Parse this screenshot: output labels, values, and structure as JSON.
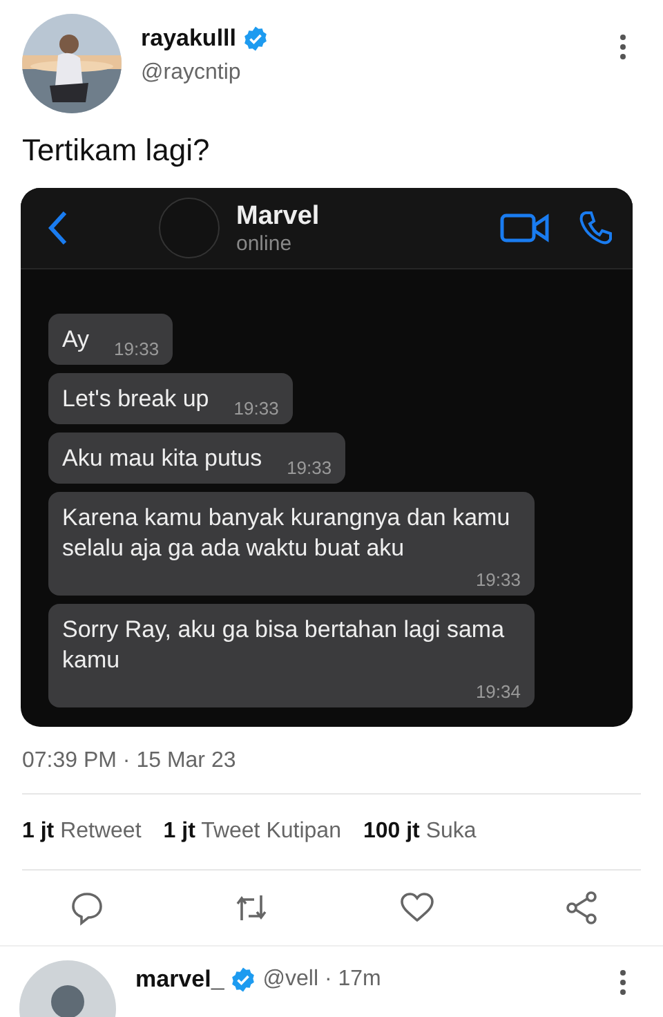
{
  "tweet": {
    "author": {
      "name": "rayakulll",
      "verified": true,
      "handle": "@raycntip"
    },
    "text": "Tertikam lagi?",
    "chat": {
      "contact": "Marvel",
      "status": "online",
      "messages": [
        {
          "text": "Ay",
          "time": "19:33"
        },
        {
          "text": "Let's break up",
          "time": "19:33"
        },
        {
          "text": "Aku mau kita putus",
          "time": "19:33"
        },
        {
          "text": "Karena kamu banyak kurangnya dan kamu selalu aja ga ada waktu buat aku",
          "time": "19:33"
        },
        {
          "text": "Sorry Ray, aku ga bisa bertahan lagi sama kamu",
          "time": "19:34"
        }
      ]
    },
    "timestamp": "07:39 PM · 15 Mar 23",
    "stats": [
      {
        "count": "1 jt",
        "label": "Retweet"
      },
      {
        "count": "1 jt",
        "label": "Tweet Kutipan"
      },
      {
        "count": "100 jt",
        "label": "Suka"
      }
    ]
  },
  "reply": {
    "name": "marvel_",
    "verified": true,
    "meta": "@vell · 17m"
  }
}
